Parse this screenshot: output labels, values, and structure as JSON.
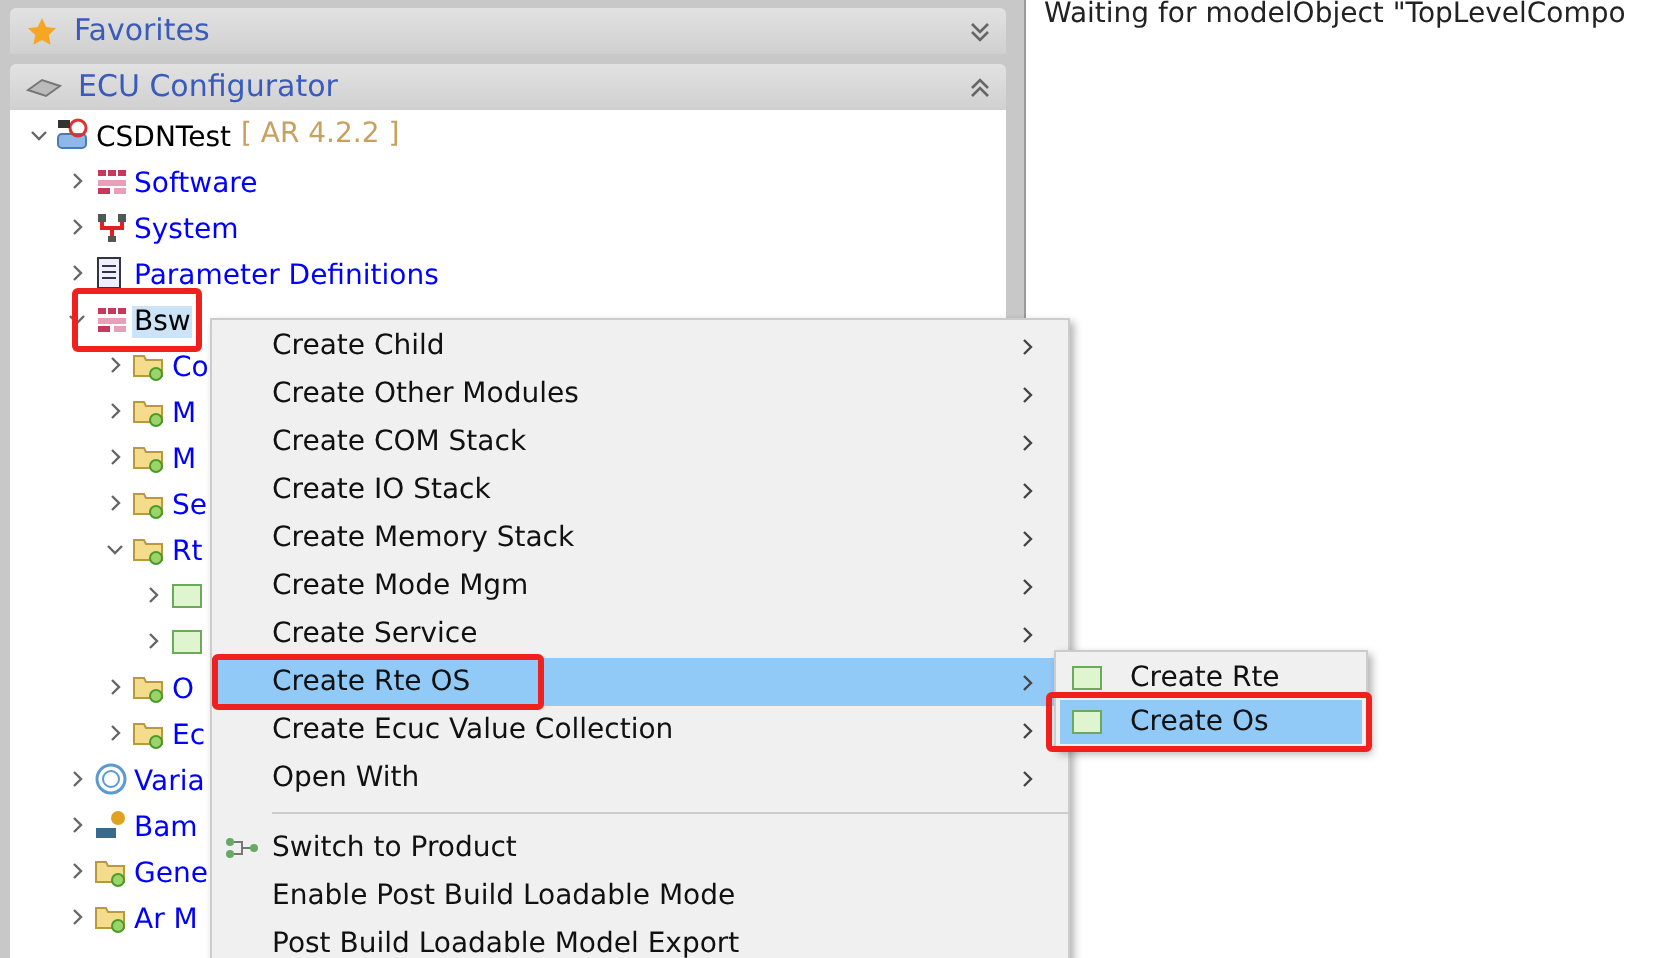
{
  "panels": [
    {
      "title": "Favorites",
      "expanded": false,
      "kind": "star"
    },
    {
      "title": "ECU Configurator",
      "expanded": true,
      "kind": "disk"
    }
  ],
  "tree": [
    {
      "label": "CSDNTest",
      "tag": "[ AR 4.2.2 ]",
      "kind": "project",
      "expanded": true,
      "selected": false,
      "children": [
        {
          "label": "Software",
          "kind": "grid",
          "expanded": false,
          "selected": false
        },
        {
          "label": "System",
          "kind": "system",
          "expanded": false,
          "selected": false
        },
        {
          "label": "Parameter Definitions",
          "kind": "document",
          "expanded": false,
          "selected": false
        },
        {
          "label": "Bsw",
          "kind": "grid",
          "expanded": true,
          "selected": true,
          "annotated": true,
          "children": [
            {
              "label": "Co",
              "kind": "folder",
              "expanded": false,
              "selected": false
            },
            {
              "label": "M",
              "kind": "folder",
              "expanded": false,
              "selected": false
            },
            {
              "label": "M",
              "kind": "folder",
              "expanded": false,
              "selected": false
            },
            {
              "label": "Se",
              "kind": "folder",
              "expanded": false,
              "selected": false
            },
            {
              "label": "Rt",
              "kind": "folder",
              "expanded": true,
              "selected": false,
              "children": [
                {
                  "kind": "module",
                  "expanded": false
                },
                {
                  "kind": "module",
                  "expanded": false
                }
              ]
            },
            {
              "label": "O",
              "kind": "folder",
              "expanded": false,
              "selected": false
            },
            {
              "label": "Ec",
              "kind": "folder",
              "expanded": false,
              "selected": false
            }
          ]
        },
        {
          "label": "Varia",
          "kind": "variant",
          "expanded": false,
          "selected": false
        },
        {
          "label": "Bam",
          "kind": "tools",
          "expanded": false,
          "selected": false
        },
        {
          "label": "Gene",
          "kind": "folder",
          "expanded": false,
          "selected": false
        },
        {
          "label": "Ar M",
          "kind": "folder",
          "expanded": false,
          "selected": false
        }
      ]
    }
  ],
  "editor": {
    "message": "Waiting for modelObject \"TopLevelCompo"
  },
  "context_menu": [
    {
      "label": "Create Child",
      "submenu": true,
      "selected": false
    },
    {
      "label": "Create Other Modules",
      "submenu": true,
      "selected": false
    },
    {
      "label": "Create COM Stack",
      "submenu": true,
      "selected": false
    },
    {
      "label": "Create IO Stack",
      "submenu": true,
      "selected": false
    },
    {
      "label": "Create Memory Stack",
      "submenu": true,
      "selected": false
    },
    {
      "label": "Create Mode Mgm",
      "submenu": true,
      "selected": false
    },
    {
      "label": "Create Service",
      "submenu": true,
      "selected": false
    },
    {
      "label": "Create Rte OS",
      "submenu": true,
      "selected": true,
      "annotated": true
    },
    {
      "label": "Create Ecuc Value Collection",
      "submenu": true,
      "selected": false
    },
    {
      "label": "Open With",
      "submenu": true,
      "selected": false,
      "separator_after": true
    },
    {
      "label": "Switch to Product",
      "submenu": false,
      "selected": false,
      "kind": "switch"
    },
    {
      "label": "Enable Post Build Loadable Mode",
      "submenu": false,
      "selected": false
    },
    {
      "label": "Post Build Loadable Model Export",
      "submenu": false,
      "selected": false
    }
  ],
  "submenu": [
    {
      "label": "Create Rte",
      "selected": false
    },
    {
      "label": "Create Os",
      "selected": true,
      "annotated": true
    }
  ]
}
